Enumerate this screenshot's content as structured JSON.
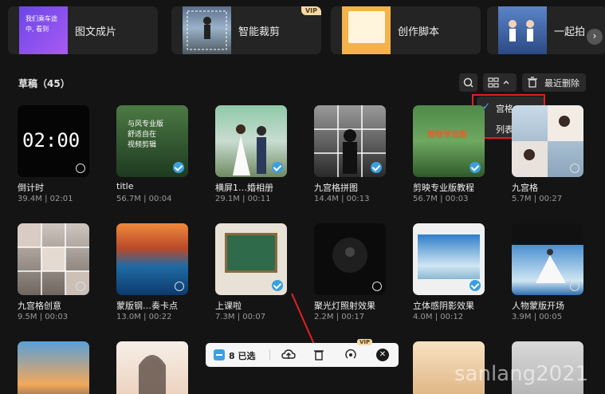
{
  "features": {
    "items": [
      {
        "label": "图文成片",
        "thumb_text": "我们乘车途中, 看到"
      },
      {
        "label": "智能裁剪",
        "badge": "VIP"
      },
      {
        "label": "创作脚本"
      },
      {
        "label": "一起拍"
      }
    ],
    "next_icon": "chevron-right-icon"
  },
  "drafts": {
    "title": "草稿（45）",
    "delete_label": "最近删除",
    "view_menu": {
      "options": [
        {
          "label": "宫格",
          "selected": true
        },
        {
          "label": "列表",
          "selected": false
        }
      ]
    }
  },
  "grid": {
    "items": [
      {
        "name": "倒计时",
        "meta": "39.4M | 02:01",
        "clock": "02:00",
        "selected": false
      },
      {
        "name": "title",
        "meta": "56.7M | 00:04",
        "lines": [
          "与风专业版",
          "舒适自在",
          "视频剪辑"
        ],
        "selected": true
      },
      {
        "name": "横屏1…婚相册",
        "meta": "29.1M | 00:11",
        "selected": true
      },
      {
        "name": "九宫格拼图",
        "meta": "14.4M | 00:13",
        "selected": true
      },
      {
        "name": "剪映专业版教程",
        "meta": "56.7M | 00:03",
        "overlay": "剪映专业版",
        "selected": true
      },
      {
        "name": "九宫格",
        "meta": "5.7M | 00:27",
        "selected": false
      },
      {
        "name": "九宫格创意",
        "meta": "9.5M | 00:03",
        "selected": false
      },
      {
        "name": "蒙版钢…奏卡点",
        "meta": "13.0M | 00:22",
        "selected": false
      },
      {
        "name": "上课啦",
        "meta": "7.3M | 00:07",
        "selected": true
      },
      {
        "name": "聚光灯照射效果",
        "meta": "2.2M | 00:17",
        "selected": false
      },
      {
        "name": "立体感阴影效果",
        "meta": "4.0M | 00:12",
        "selected": true
      },
      {
        "name": "人物蒙版开场",
        "meta": "3.9M | 00:05",
        "selected": false
      }
    ]
  },
  "selection_bar": {
    "count_label": "8 已选",
    "badge": "VIP"
  },
  "watermark": "sanlang2021",
  "colors": {
    "background": "#141414",
    "accent": "#3a9fe0",
    "highlight_box": "#e02020"
  }
}
